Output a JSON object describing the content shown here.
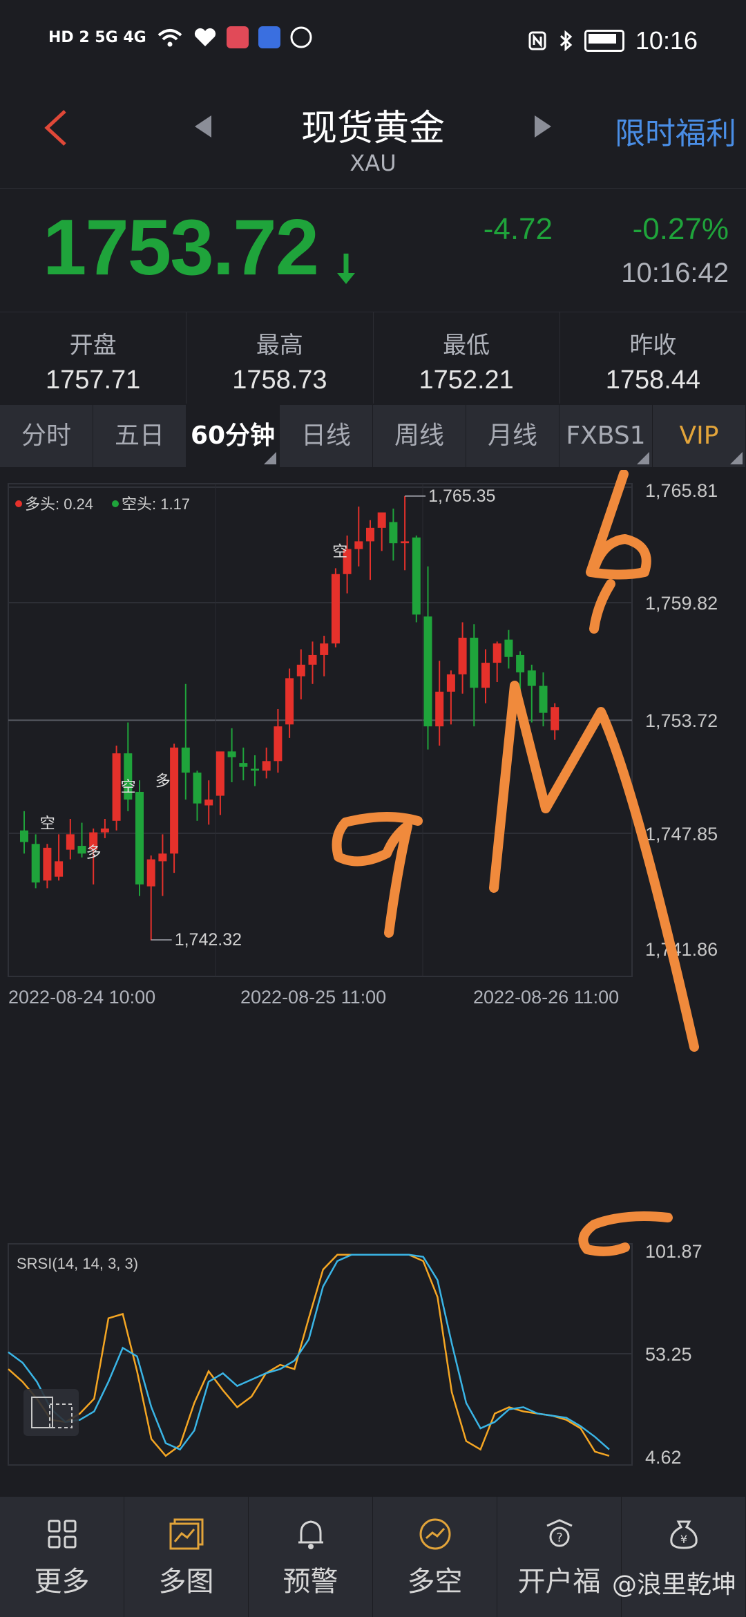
{
  "status_bar": {
    "network": "HD 2 5G 4G",
    "time": "10:16"
  },
  "header": {
    "back_icon": "chevron-left-icon",
    "title": "现货黄金",
    "subtitle": "XAU",
    "promo": "限时福利"
  },
  "quote": {
    "price": "1753.72",
    "change": "-4.72",
    "change_pct": "-0.27%",
    "time": "10:16:42",
    "color_down": "#1fa43b",
    "color_up": "#e5312b"
  },
  "stats": [
    {
      "label": "开盘",
      "value": "1757.71"
    },
    {
      "label": "最高",
      "value": "1758.73"
    },
    {
      "label": "最低",
      "value": "1752.21"
    },
    {
      "label": "昨收",
      "value": "1758.44"
    }
  ],
  "tabs": [
    {
      "label": "分时"
    },
    {
      "label": "五日"
    },
    {
      "label": "60分钟"
    },
    {
      "label": "日线"
    },
    {
      "label": "周线"
    },
    {
      "label": "月线"
    },
    {
      "label": "FXBS1"
    },
    {
      "label": "VIP"
    }
  ],
  "chart_data": [
    {
      "type": "candlestick",
      "legend": [
        {
          "label": "多头: 0.24",
          "color": "#e5312b"
        },
        {
          "label": "空头: 1.17",
          "color": "#1fa43b"
        }
      ],
      "y_ticks": [
        "1,765.81",
        "1,759.82",
        "1,753.72",
        "1,747.85",
        "1,741.86"
      ],
      "ylim": [
        1741.86,
        1765.81
      ],
      "current_price": "1753.72",
      "x_ticks": [
        "2022-08-24 10:00",
        "2022-08-25 11:00",
        "2022-08-26 11:00"
      ],
      "annotations": [
        {
          "text": "1,765.35",
          "value": 1765.35
        },
        {
          "text": "1,742.32",
          "value": 1742.32
        }
      ],
      "signals": [
        {
          "text": "空",
          "value": 1748.1
        },
        {
          "text": "多",
          "value": 1746.6
        },
        {
          "text": "空",
          "value": 1750.0
        },
        {
          "text": "多",
          "value": 1750.3
        },
        {
          "text": "空",
          "value": 1762.2
        }
      ],
      "candles": [
        [
          1748.0,
          1749.0,
          1746.8,
          1747.4
        ],
        [
          1747.3,
          1747.8,
          1745.0,
          1745.3
        ],
        [
          1745.4,
          1747.3,
          1745.0,
          1747.1
        ],
        [
          1745.6,
          1747.8,
          1745.4,
          1746.4
        ],
        [
          1747.0,
          1748.6,
          1746.5,
          1747.8
        ],
        [
          1747.2,
          1748.4,
          1746.6,
          1746.8
        ],
        [
          1747.0,
          1748.1,
          1745.2,
          1747.9
        ],
        [
          1747.9,
          1748.6,
          1747.6,
          1748.1
        ],
        [
          1748.5,
          1752.4,
          1748.0,
          1752.0
        ],
        [
          1752.0,
          1753.6,
          1749.0,
          1749.6
        ],
        [
          1750.0,
          1750.6,
          1744.6,
          1745.2
        ],
        [
          1745.1,
          1746.7,
          1742.3,
          1746.5
        ],
        [
          1746.4,
          1747.8,
          1744.6,
          1746.8
        ],
        [
          1746.8,
          1752.5,
          1745.8,
          1752.3
        ],
        [
          1752.3,
          1755.6,
          1749.6,
          1751.0
        ],
        [
          1751.0,
          1751.1,
          1748.5,
          1749.4
        ],
        [
          1749.3,
          1750.6,
          1748.3,
          1749.6
        ],
        [
          1749.8,
          1751.8,
          1748.8,
          1752.1
        ],
        [
          1752.1,
          1753.3,
          1750.5,
          1751.8
        ],
        [
          1751.5,
          1752.3,
          1750.6,
          1751.3
        ],
        [
          1751.2,
          1751.9,
          1750.3,
          1751.1
        ],
        [
          1751.1,
          1752.3,
          1750.7,
          1751.6
        ],
        [
          1751.6,
          1754.3,
          1751.0,
          1753.4
        ],
        [
          1753.5,
          1756.4,
          1752.8,
          1755.9
        ],
        [
          1756.0,
          1757.4,
          1754.8,
          1756.6
        ],
        [
          1756.6,
          1757.8,
          1755.6,
          1757.1
        ],
        [
          1757.1,
          1758.1,
          1756.0,
          1757.7
        ],
        [
          1757.7,
          1761.6,
          1757.5,
          1761.3
        ],
        [
          1761.3,
          1763.3,
          1760.3,
          1762.6
        ],
        [
          1762.6,
          1764.8,
          1761.7,
          1763.0
        ],
        [
          1763.0,
          1764.1,
          1761.0,
          1763.7
        ],
        [
          1763.7,
          1764.4,
          1762.5,
          1764.5
        ],
        [
          1764.0,
          1764.7,
          1762.0,
          1762.9
        ],
        [
          1762.9,
          1765.35,
          1761.5,
          1763.0
        ],
        [
          1763.2,
          1763.3,
          1758.8,
          1759.2
        ],
        [
          1759.1,
          1761.7,
          1752.2,
          1753.4
        ],
        [
          1753.4,
          1756.8,
          1752.4,
          1755.2
        ],
        [
          1755.2,
          1756.3,
          1753.5,
          1756.1
        ],
        [
          1756.1,
          1758.8,
          1755.1,
          1758.0
        ],
        [
          1758.0,
          1758.7,
          1753.4,
          1755.4
        ],
        [
          1755.4,
          1757.4,
          1754.6,
          1756.7
        ],
        [
          1756.7,
          1757.8,
          1755.7,
          1757.7
        ],
        [
          1757.9,
          1758.4,
          1756.4,
          1757.0
        ],
        [
          1757.1,
          1757.3,
          1754.4,
          1756.2
        ],
        [
          1756.3,
          1756.6,
          1753.6,
          1755.5
        ],
        [
          1755.5,
          1756.2,
          1753.4,
          1754.1
        ],
        [
          1753.2,
          1754.6,
          1752.7,
          1754.4
        ]
      ]
    },
    {
      "type": "line",
      "title": "SRSI(14, 14, 3, 3)",
      "y_ticks": [
        "101.87",
        "53.25",
        "4.62"
      ],
      "ylim": [
        4.62,
        101.87
      ],
      "series": [
        {
          "color": "#f5a623",
          "values": [
            46,
            40,
            32,
            22,
            21,
            25,
            32,
            70,
            72,
            45,
            13,
            5,
            10,
            30,
            45,
            36,
            28,
            33,
            44,
            48,
            46,
            70,
            93,
            100,
            100,
            100,
            100,
            100,
            100,
            97,
            80,
            35,
            12,
            8,
            25,
            28,
            26,
            25,
            24,
            22,
            18,
            7,
            5
          ]
        },
        {
          "color": "#3ab5e6",
          "values": [
            54,
            49,
            40,
            27,
            21,
            22,
            26,
            40,
            56,
            52,
            28,
            11,
            8,
            17,
            40,
            44,
            38,
            41,
            44,
            46,
            50,
            60,
            85,
            97,
            100,
            100,
            100,
            100,
            100,
            99,
            88,
            58,
            30,
            18,
            21,
            27,
            28,
            25,
            24,
            23,
            19,
            14,
            8
          ]
        }
      ]
    }
  ],
  "bottom_nav": [
    {
      "label": "更多",
      "icon": "grid-icon"
    },
    {
      "label": "多图",
      "icon": "multi-chart-icon"
    },
    {
      "label": "预警",
      "icon": "bell-icon"
    },
    {
      "label": "多空",
      "icon": "trend-circle-icon"
    },
    {
      "label": "开户福",
      "icon": "gift-icon"
    },
    {
      "label": "",
      "icon": "money-bag-icon"
    }
  ],
  "watermark": "@浪里乾坤",
  "handwriting": {
    "color": "#f08a3c",
    "strokes": [
      "9",
      "b",
      "c",
      "M"
    ]
  }
}
